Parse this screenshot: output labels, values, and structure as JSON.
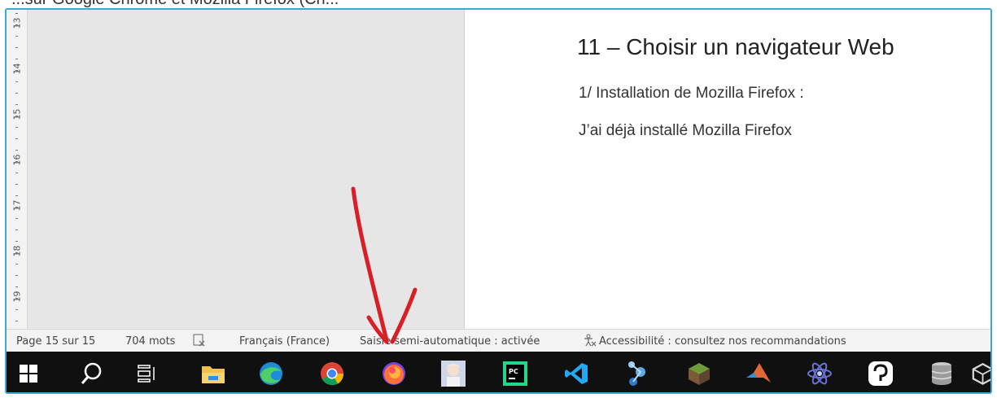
{
  "top_clip_text": "...sur Google Chrome et Mozilla Firefox (Ch...",
  "ruler": {
    "numbers": [
      "13",
      "14",
      "15",
      "16",
      "17",
      "18",
      "19"
    ]
  },
  "document": {
    "heading": "11 – Choisir un navigateur Web",
    "paragraph1": "1/ Installation de Mozilla Firefox :",
    "paragraph2": "J’ai déjà installé Mozilla Firefox"
  },
  "status_bar": {
    "page": "Page 15 sur 15",
    "words": "704 mots",
    "language": "Français (France)",
    "autocomplete": "Saisie semi-automatique : activée",
    "accessibility": "Accessibilité : consultez nos recommandations"
  },
  "taskbar": {
    "icons": [
      "windows-start-icon",
      "search-icon",
      "task-view-icon",
      "file-explorer-icon",
      "edge-icon",
      "chrome-icon",
      "firefox-icon",
      "anime-app-icon",
      "pycharm-icon",
      "vscode-icon",
      "network-app-icon",
      "minecraft-icon",
      "matlab-icon",
      "atom-app-icon",
      "speech-app-icon",
      "database-icon",
      "virtualbox-icon"
    ],
    "pycharm_label": "PC"
  },
  "colors": {
    "frame_border": "#3ea7d6",
    "taskbar_bg": "#101010",
    "arrow": "#d81f26"
  }
}
